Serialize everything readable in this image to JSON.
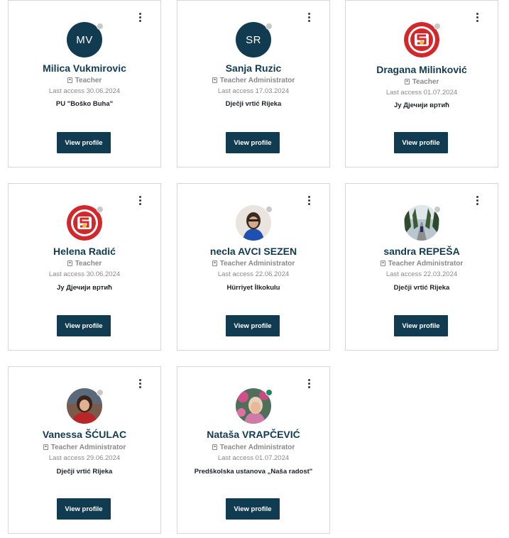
{
  "people": [
    {
      "name": "Milica Vukmirovic",
      "initials": "MV",
      "role": "Teacher",
      "last_access": "Last access 30.06.2024",
      "institution": "PU \"Boško Buha\"",
      "button": "View profile",
      "avatar": "initials",
      "online": false
    },
    {
      "name": "Sanja Ruzic",
      "initials": "SR",
      "role": "Teacher Administrator",
      "last_access": "Last access  17.03.2024",
      "institution": "Dječji vrtić Rijeka",
      "button": "View profile",
      "avatar": "initials",
      "online": false
    },
    {
      "name": "Dragana Milinković",
      "role": "Teacher",
      "last_access": "Last access 01.07.2024",
      "institution": "Ју Дјечији вртић",
      "button": "View profile",
      "avatar": "logo",
      "online": false
    },
    {
      "name": "Helena Radić",
      "role": "Teacher",
      "last_access": "Last access 30.06.2024",
      "institution": "Ју Дјечији вртић",
      "button": "View profile",
      "avatar": "logo",
      "online": false
    },
    {
      "name": "necla AVCI SEZEN",
      "role": "Teacher Administrator",
      "last_access": "Last access  22.06.2024",
      "institution": "Hürriyet İlkokulu",
      "button": "View profile",
      "avatar": "photo-woman-blue",
      "online": false
    },
    {
      "name": "sandra REPEŠA",
      "role": "Teacher Administrator",
      "last_access": "Last access 22.03.2024",
      "institution": "Dječji vrtić Rijeka",
      "button": "View profile",
      "avatar": "photo-road",
      "online": false
    },
    {
      "name": "Vanessa  ŠĆULAC",
      "role": "Teacher Administrator",
      "last_access": "Last access 29.06.2024",
      "institution": "Dječji vrtić Rijeka",
      "button": "View profile",
      "avatar": "photo-woman-red",
      "online": false
    },
    {
      "name": "Nataša VRAPČEVIĆ",
      "role": "Teacher Administrator",
      "last_access": "Last access  01.07.2024",
      "institution": "Predškolska ustanova „Naša radost\"",
      "button": "View profile",
      "avatar": "photo-woman-pink",
      "online": true
    }
  ],
  "colors": {
    "primary": "#113b51",
    "muted": "#8a8a8a",
    "online": "#1a8a5a",
    "offline": "#c9c9c9",
    "logo_red": "#d2282c"
  },
  "icons": {
    "menu": "kebab-icon",
    "role": "badge-icon"
  }
}
